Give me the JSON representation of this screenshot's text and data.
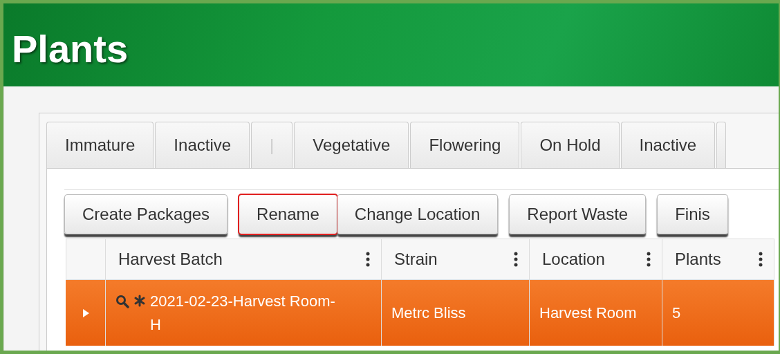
{
  "header": {
    "title": "Plants"
  },
  "tabs": [
    {
      "kind": "tab",
      "label": "Immature",
      "selected": false
    },
    {
      "kind": "tab",
      "label": "Inactive",
      "selected": false
    },
    {
      "kind": "separator",
      "label": "|"
    },
    {
      "kind": "tab",
      "label": "Vegetative",
      "selected": false
    },
    {
      "kind": "tab",
      "label": "Flowering",
      "selected": false
    },
    {
      "kind": "tab",
      "label": "On Hold",
      "selected": false
    },
    {
      "kind": "tab",
      "label": "Inactive",
      "selected": false
    },
    {
      "kind": "stub",
      "selected": false
    }
  ],
  "toolbar": [
    {
      "label": "Create Packages",
      "highlighted": false,
      "joined_with_next": false
    },
    {
      "label": "Rename",
      "highlighted": true,
      "joined_with_next": true
    },
    {
      "label": "Change Location",
      "highlighted": false,
      "joined_with_next": false
    },
    {
      "label": "Report Waste",
      "highlighted": false,
      "joined_with_next": false
    },
    {
      "label": "Finis",
      "highlighted": false,
      "joined_with_next": false
    }
  ],
  "table": {
    "columns": [
      "Harvest Batch",
      "Strain",
      "Location",
      "Plants"
    ],
    "rows": [
      {
        "selected": true,
        "expanded": false,
        "cells": [
          "2021-02-23-Harvest Room-H",
          "Metrc Bliss",
          "Harvest Room",
          "5"
        ]
      }
    ]
  }
}
